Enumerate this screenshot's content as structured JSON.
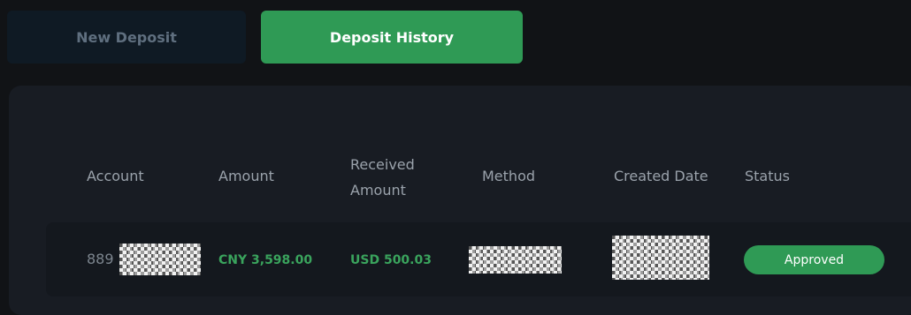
{
  "tabs": {
    "new_deposit": "New Deposit",
    "deposit_history": "Deposit History"
  },
  "table": {
    "headers": {
      "account": "Account",
      "amount": "Amount",
      "received_line1": "Received",
      "received_line2": "Amount",
      "method": "Method",
      "created_date": "Created Date",
      "status": "Status"
    },
    "rows": [
      {
        "account_prefix": "889",
        "account_redacted": true,
        "amount": "CNY 3,598.00",
        "received_amount": "USD 500.03",
        "method_redacted": true,
        "created_date_redacted": true,
        "status": "Approved"
      }
    ]
  },
  "colors": {
    "accent_green": "#2f9a55",
    "amount_green": "#3aa45d",
    "background": "#111316",
    "panel": "#181c23"
  }
}
